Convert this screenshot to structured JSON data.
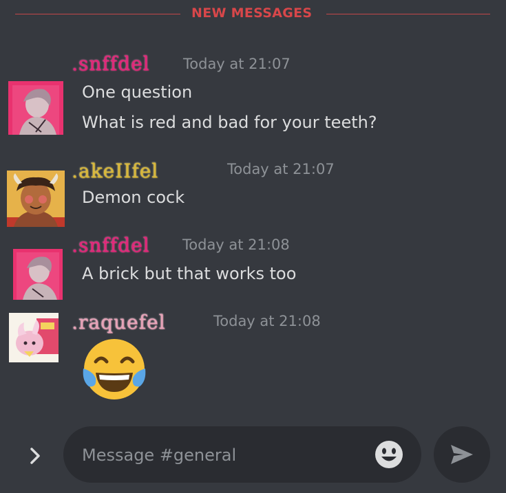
{
  "divider": {
    "label": "NEW MESSAGES",
    "color": "#d8474a"
  },
  "messages": [
    {
      "username": ".snffdel",
      "time": "Today at 21:07",
      "lines": [
        "One question",
        "What is red and bad for your teeth?"
      ]
    },
    {
      "username": ".akeIIfel",
      "time": "Today at 21:07",
      "lines": [
        "Demon cock"
      ]
    },
    {
      "username": ".snffdel",
      "time": "Today at 21:08",
      "lines": [
        "A brick but that works too"
      ]
    },
    {
      "username": ".raquefel",
      "time": "Today at 21:08",
      "emoji": "face-with-tears-of-joy"
    }
  ],
  "composer": {
    "placeholder": "Message #general"
  },
  "icons": {
    "expand": "chevron-right-icon",
    "emoji_picker": "smiley-icon",
    "send": "send-icon"
  },
  "colors": {
    "background": "#36393f",
    "composer": "#2a2c31",
    "timestamp": "#8e9297",
    "text": "#dcddde"
  }
}
